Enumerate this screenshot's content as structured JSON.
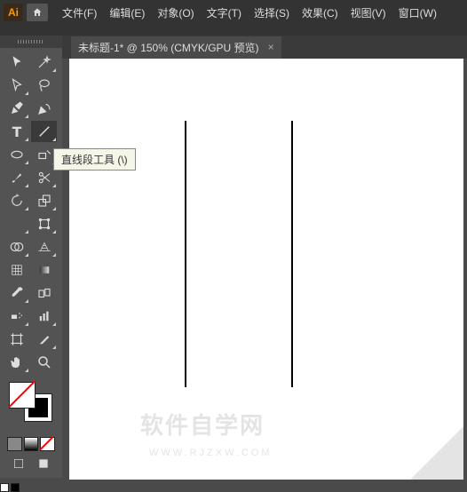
{
  "app": {
    "logo_text": "Ai"
  },
  "menu": {
    "items": [
      {
        "label": "文件(F)"
      },
      {
        "label": "编辑(E)"
      },
      {
        "label": "对象(O)"
      },
      {
        "label": "文字(T)"
      },
      {
        "label": "选择(S)"
      },
      {
        "label": "效果(C)"
      },
      {
        "label": "视图(V)"
      },
      {
        "label": "窗口(W)"
      }
    ]
  },
  "tab": {
    "title": "未标题-1* @ 150% (CMYK/GPU 预览)",
    "close": "×"
  },
  "tooltip": {
    "text": "直线段工具 (\\)"
  },
  "watermark": {
    "main": "软件自学网",
    "sub": "WWW.RJZXW.COM"
  },
  "tools": {
    "names": [
      [
        "selection-tool",
        "magic-wand-tool"
      ],
      [
        "direct-selection-tool",
        "lasso-tool"
      ],
      [
        "pen-tool",
        "curvature-tool"
      ],
      [
        "type-tool",
        "line-segment-tool"
      ],
      [
        "ellipse-tool",
        "shaper-tool"
      ],
      [
        "paintbrush-tool",
        "scissors-tool"
      ],
      [
        "rotate-tool",
        "scale-tool"
      ],
      [
        "width-tool",
        "free-transform-tool"
      ],
      [
        "shape-builder-tool",
        "perspective-grid-tool"
      ],
      [
        "mesh-tool",
        "gradient-tool"
      ],
      [
        "eyedropper-tool",
        "blend-tool"
      ],
      [
        "symbol-sprayer-tool",
        "column-graph-tool"
      ],
      [
        "artboard-tool",
        "slice-tool"
      ],
      [
        "hand-tool",
        "zoom-tool"
      ]
    ]
  }
}
